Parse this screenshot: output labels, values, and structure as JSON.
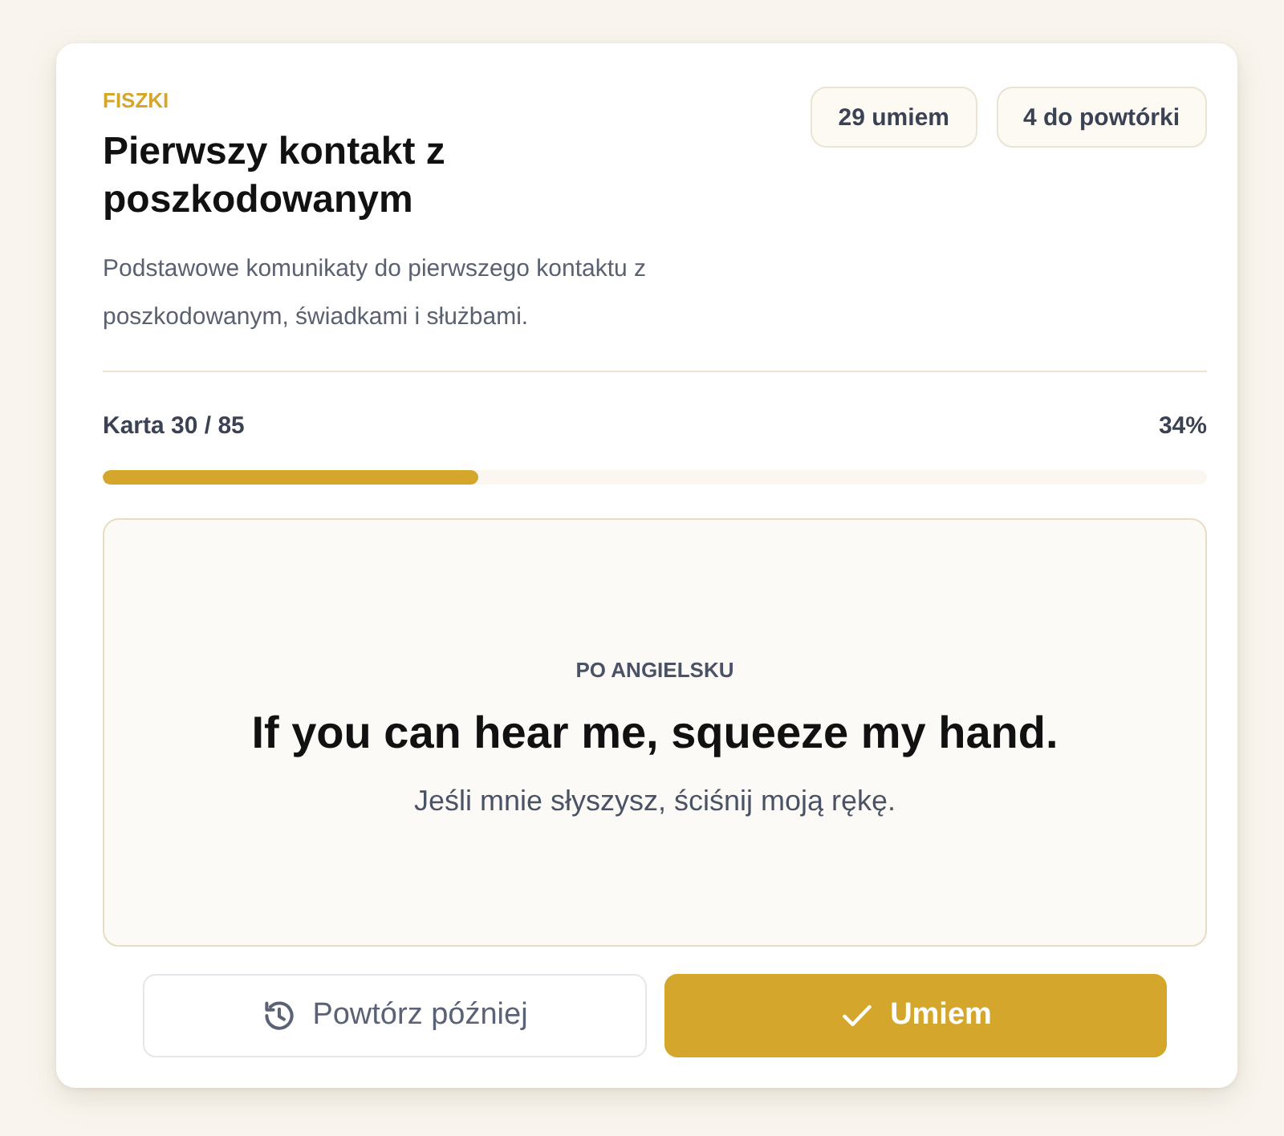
{
  "header": {
    "eyebrow": "FISZKI",
    "title": "Pierwszy kontakt z poszkodowanym",
    "description": "Podstawowe komunikaty do pierwszego kontaktu z poszkodowanym, świadkami i służbami.",
    "badges": [
      "29 umiem",
      "4 do powtórki"
    ]
  },
  "progress": {
    "label": "Karta 30 / 85",
    "percent": "34%",
    "level": 0.34
  },
  "flashcard": {
    "language": "PO ANGIELSKU",
    "phrase": "If you can hear me, squeeze my hand.",
    "translation": "Jeśli mnie słyszysz, ściśnij moją rękę."
  },
  "actions": [
    {
      "kind": "later",
      "label": "Powtórz później"
    },
    {
      "kind": "known",
      "label": "Umiem"
    }
  ]
}
